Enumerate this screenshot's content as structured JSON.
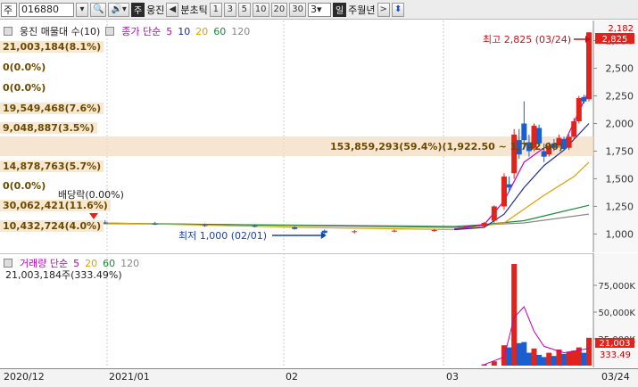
{
  "toolbar": {
    "market": "주",
    "code": "016880",
    "type_badge": "주",
    "stock_name": "웅진",
    "tick_label": "분초틱",
    "intervals": [
      "1",
      "3",
      "5",
      "10",
      "20",
      "30"
    ],
    "period_value": "3",
    "day": "일",
    "week_month_year": "주월년",
    "next": ">",
    "prev": "◀"
  },
  "main": {
    "legend_title": "웅진 매물대 수(10)",
    "ma_title": "종가 단순",
    "ma_periods": [
      "5",
      "10",
      "20",
      "60",
      "120"
    ],
    "ma_colors": [
      "#c000c0",
      "#1c2c9c",
      "#e0a000",
      "#1a8a3a",
      "#888888"
    ],
    "stats": [
      "21,003,184(8.1%)",
      "0(0.0%)",
      "0(0.0%)",
      "19,549,468(7.6%)",
      "9,048,887(3.5%)",
      "14,878,763(5.7%)",
      "0(0.0%)",
      "30,062,421(11.6%)",
      "10,432,724(4.0%)"
    ],
    "big_stat": "153,859,293(59.4%)(1,922.50 ~ 1,742.00)",
    "high_label": "최고 2,825 (03/24)",
    "low_label": "최저 1,000 (02/01)",
    "dividend_label": "배당락(0.00%)",
    "last_price": "2,825",
    "y_top": "2,182",
    "y_labels": [
      "2,750",
      "2,500",
      "2,250",
      "2,000",
      "1,750",
      "1,500",
      "1,250",
      "1,000"
    ]
  },
  "volume": {
    "legend_title": "거래량 단순",
    "ma_periods": [
      "5",
      "20",
      "60",
      "120"
    ],
    "ma_colors": [
      "#c000c0",
      "#e0a000",
      "#1a8a3a",
      "#888888"
    ],
    "latest": "21,003,184주(333.49%)",
    "y_labels": [
      "75,000K",
      "50,000K",
      "25,000K"
    ],
    "last_value": "21,003",
    "last_pct": "333.49"
  },
  "xaxis": {
    "labels": [
      "2020/12",
      "2021/01",
      "02",
      "03",
      "03/24"
    ]
  },
  "chart_data": {
    "type": "candlestick",
    "price_range": [
      850,
      2900
    ],
    "volume_max_k": 100000,
    "sessions": 118,
    "candles": [
      {
        "i": 20,
        "o": 1105,
        "h": 1125,
        "l": 1090,
        "c": 1100
      },
      {
        "i": 30,
        "o": 1095,
        "h": 1110,
        "l": 1080,
        "c": 1085
      },
      {
        "i": 40,
        "o": 1080,
        "h": 1095,
        "l": 1065,
        "c": 1075
      },
      {
        "i": 50,
        "o": 1075,
        "h": 1085,
        "l": 1060,
        "c": 1065
      },
      {
        "i": 58,
        "o": 1060,
        "h": 1070,
        "l": 1040,
        "c": 1045
      },
      {
        "i": 64,
        "o": 1030,
        "h": 1040,
        "l": 1000,
        "c": 1010
      },
      {
        "i": 70,
        "o": 1020,
        "h": 1035,
        "l": 1005,
        "c": 1025
      },
      {
        "i": 78,
        "o": 1025,
        "h": 1040,
        "l": 1015,
        "c": 1030
      },
      {
        "i": 86,
        "o": 1030,
        "h": 1045,
        "l": 1020,
        "c": 1035
      },
      {
        "i": 92,
        "o": 1050,
        "h": 1070,
        "l": 1040,
        "c": 1060
      },
      {
        "i": 96,
        "o": 1070,
        "h": 1110,
        "l": 1060,
        "c": 1100
      },
      {
        "i": 98,
        "o": 1120,
        "h": 1260,
        "l": 1100,
        "c": 1250
      },
      {
        "i": 100,
        "o": 1250,
        "h": 1550,
        "l": 1220,
        "c": 1520
      },
      {
        "i": 101,
        "o": 1450,
        "h": 1520,
        "l": 1380,
        "c": 1420
      },
      {
        "i": 102,
        "o": 1550,
        "h": 1950,
        "l": 1500,
        "c": 1900
      },
      {
        "i": 103,
        "o": 1850,
        "h": 1950,
        "l": 1680,
        "c": 1720
      },
      {
        "i": 104,
        "o": 2000,
        "h": 2200,
        "l": 1780,
        "c": 1850
      },
      {
        "i": 105,
        "o": 1830,
        "h": 1900,
        "l": 1700,
        "c": 1750
      },
      {
        "i": 106,
        "o": 1780,
        "h": 2000,
        "l": 1750,
        "c": 1980
      },
      {
        "i": 107,
        "o": 1960,
        "h": 1990,
        "l": 1800,
        "c": 1820
      },
      {
        "i": 108,
        "o": 1750,
        "h": 1820,
        "l": 1650,
        "c": 1700
      },
      {
        "i": 109,
        "o": 1720,
        "h": 1830,
        "l": 1700,
        "c": 1800
      },
      {
        "i": 110,
        "o": 1820,
        "h": 1860,
        "l": 1750,
        "c": 1780
      },
      {
        "i": 111,
        "o": 1800,
        "h": 1900,
        "l": 1780,
        "c": 1870
      },
      {
        "i": 112,
        "o": 1860,
        "h": 1880,
        "l": 1760,
        "c": 1770
      },
      {
        "i": 113,
        "o": 1780,
        "h": 1900,
        "l": 1760,
        "c": 1880
      },
      {
        "i": 114,
        "o": 1880,
        "h": 2050,
        "l": 1850,
        "c": 2020
      },
      {
        "i": 115,
        "o": 2020,
        "h": 2250,
        "l": 2000,
        "c": 2230
      },
      {
        "i": 116,
        "o": 2240,
        "h": 2260,
        "l": 2180,
        "c": 2200
      },
      {
        "i": 117,
        "o": 2220,
        "h": 2825,
        "l": 2200,
        "c": 2825
      }
    ],
    "ma5": [
      [
        90,
        1045
      ],
      [
        96,
        1085
      ],
      [
        100,
        1300
      ],
      [
        104,
        1650
      ],
      [
        108,
        1780
      ],
      [
        112,
        1820
      ],
      [
        117,
        2300
      ]
    ],
    "ma10": [
      [
        90,
        1040
      ],
      [
        96,
        1060
      ],
      [
        100,
        1180
      ],
      [
        104,
        1420
      ],
      [
        108,
        1620
      ],
      [
        112,
        1760
      ],
      [
        117,
        2000
      ]
    ],
    "ma20": [
      [
        0,
        1120
      ],
      [
        60,
        1060
      ],
      [
        90,
        1040
      ],
      [
        100,
        1100
      ],
      [
        108,
        1350
      ],
      [
        114,
        1520
      ],
      [
        117,
        1650
      ]
    ],
    "ma60": [
      [
        0,
        1110
      ],
      [
        90,
        1060
      ],
      [
        104,
        1120
      ],
      [
        117,
        1260
      ]
    ],
    "ma120": [
      [
        0,
        1100
      ],
      [
        90,
        1070
      ],
      [
        104,
        1100
      ],
      [
        117,
        1180
      ]
    ],
    "volume_k": [
      {
        "i": 96,
        "v": 1200
      },
      {
        "i": 98,
        "v": 4000
      },
      {
        "i": 100,
        "v": 19000
      },
      {
        "i": 101,
        "v": 17000
      },
      {
        "i": 102,
        "v": 95000
      },
      {
        "i": 103,
        "v": 21000
      },
      {
        "i": 104,
        "v": 22000
      },
      {
        "i": 105,
        "v": 12000
      },
      {
        "i": 106,
        "v": 16000
      },
      {
        "i": 107,
        "v": 10000
      },
      {
        "i": 108,
        "v": 8000
      },
      {
        "i": 109,
        "v": 12000
      },
      {
        "i": 110,
        "v": 9000
      },
      {
        "i": 111,
        "v": 15000
      },
      {
        "i": 112,
        "v": 11000
      },
      {
        "i": 113,
        "v": 13000
      },
      {
        "i": 114,
        "v": 14000
      },
      {
        "i": 115,
        "v": 17000
      },
      {
        "i": 116,
        "v": 12000
      },
      {
        "i": 117,
        "v": 26000
      }
    ],
    "vol_ma5": [
      [
        96,
        1000
      ],
      [
        100,
        8000
      ],
      [
        102,
        45000
      ],
      [
        104,
        55000
      ],
      [
        106,
        32000
      ],
      [
        108,
        18000
      ],
      [
        112,
        12000
      ],
      [
        117,
        16000
      ]
    ]
  }
}
